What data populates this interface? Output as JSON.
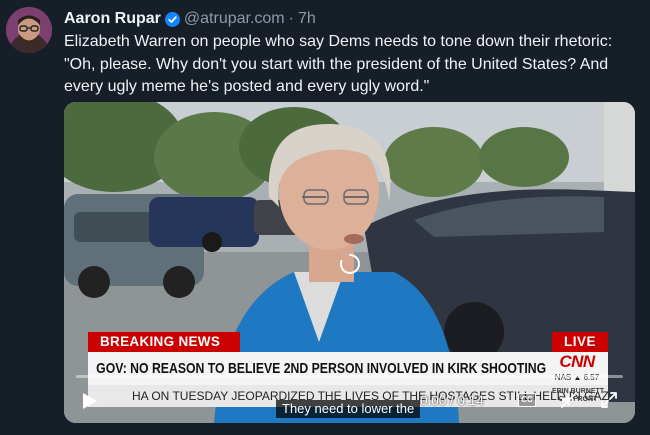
{
  "post": {
    "author_name": "Aaron Rupar",
    "handle": "@atrupar.com",
    "separator": "·",
    "time": "7h",
    "text": "Elizabeth Warren on people who say Dems needs to tone down their rhetoric: \"Oh, please. Why don't you start with the president of the United States? And every ugly meme he's posted and every ugly word.\""
  },
  "video": {
    "breaking_label": "BREAKING NEWS",
    "live_label": "LIVE",
    "headline": "GOV: NO REASON TO BELIEVE 2ND PERSON INVOLVED IN KIRK SHOOTING",
    "network_logo": "CNN",
    "market_ticker": "NAS ▲ 6.57",
    "ticker_text": "HA ON TUESDAY JEOPARDIZED THE LIVES OF THE HOSTAGES STILL HELD IN GAZA.",
    "ticker_right": "ERIN BURNETT OUTFRONT",
    "caption": "They need to lower the",
    "timecode": "0:00 / 0:14",
    "cc_label": "CC",
    "progress": 0.0
  },
  "colors": {
    "background": "#161e27",
    "cnn_red": "#cc0000",
    "verified_blue": "#1185fe",
    "muted_text": "#8e9aa8"
  },
  "icons": {
    "verified": "verified-check-icon",
    "play": "play-icon",
    "mute": "muted-speaker-icon",
    "fullscreen": "fullscreen-icon",
    "loading": "loading-spinner-icon"
  }
}
